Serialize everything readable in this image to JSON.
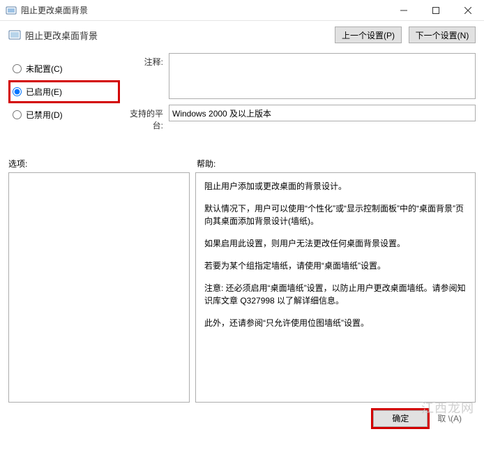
{
  "window": {
    "title": "阻止更改桌面背景"
  },
  "header": {
    "title": "阻止更改桌面背景",
    "prev_btn": "上一个设置(P)",
    "next_btn": "下一个设置(N)"
  },
  "radios": {
    "not_configured": "未配置(C)",
    "enabled": "已启用(E)",
    "disabled": "已禁用(D)",
    "selected": "enabled"
  },
  "form": {
    "comment_label": "注释:",
    "comment_value": "",
    "platform_label": "支持的平台:",
    "platform_value": "Windows 2000 及以上版本"
  },
  "sections": {
    "options_label": "选项:",
    "help_label": "帮助:"
  },
  "help": {
    "p1": "阻止用户添加或更改桌面的背景设计。",
    "p2": "默认情况下，用户可以使用“个性化”或“显示控制面板”中的“桌面背景”页向其桌面添加背景设计(墙纸)。",
    "p3": "如果启用此设置，则用户无法更改任何桌面背景设置。",
    "p4": "若要为某个组指定墙纸，请使用“桌面墙纸”设置。",
    "p5": "注意: 还必须启用“桌面墙纸”设置，以防止用户更改桌面墙纸。请参阅知识库文章 Q327998 以了解详细信息。",
    "p6": "此外，还请参阅“只允许使用位图墙纸”设置。"
  },
  "footer": {
    "ok": "确定",
    "cancel_stub": "取    \\(A)"
  },
  "watermark": "江西龙网"
}
